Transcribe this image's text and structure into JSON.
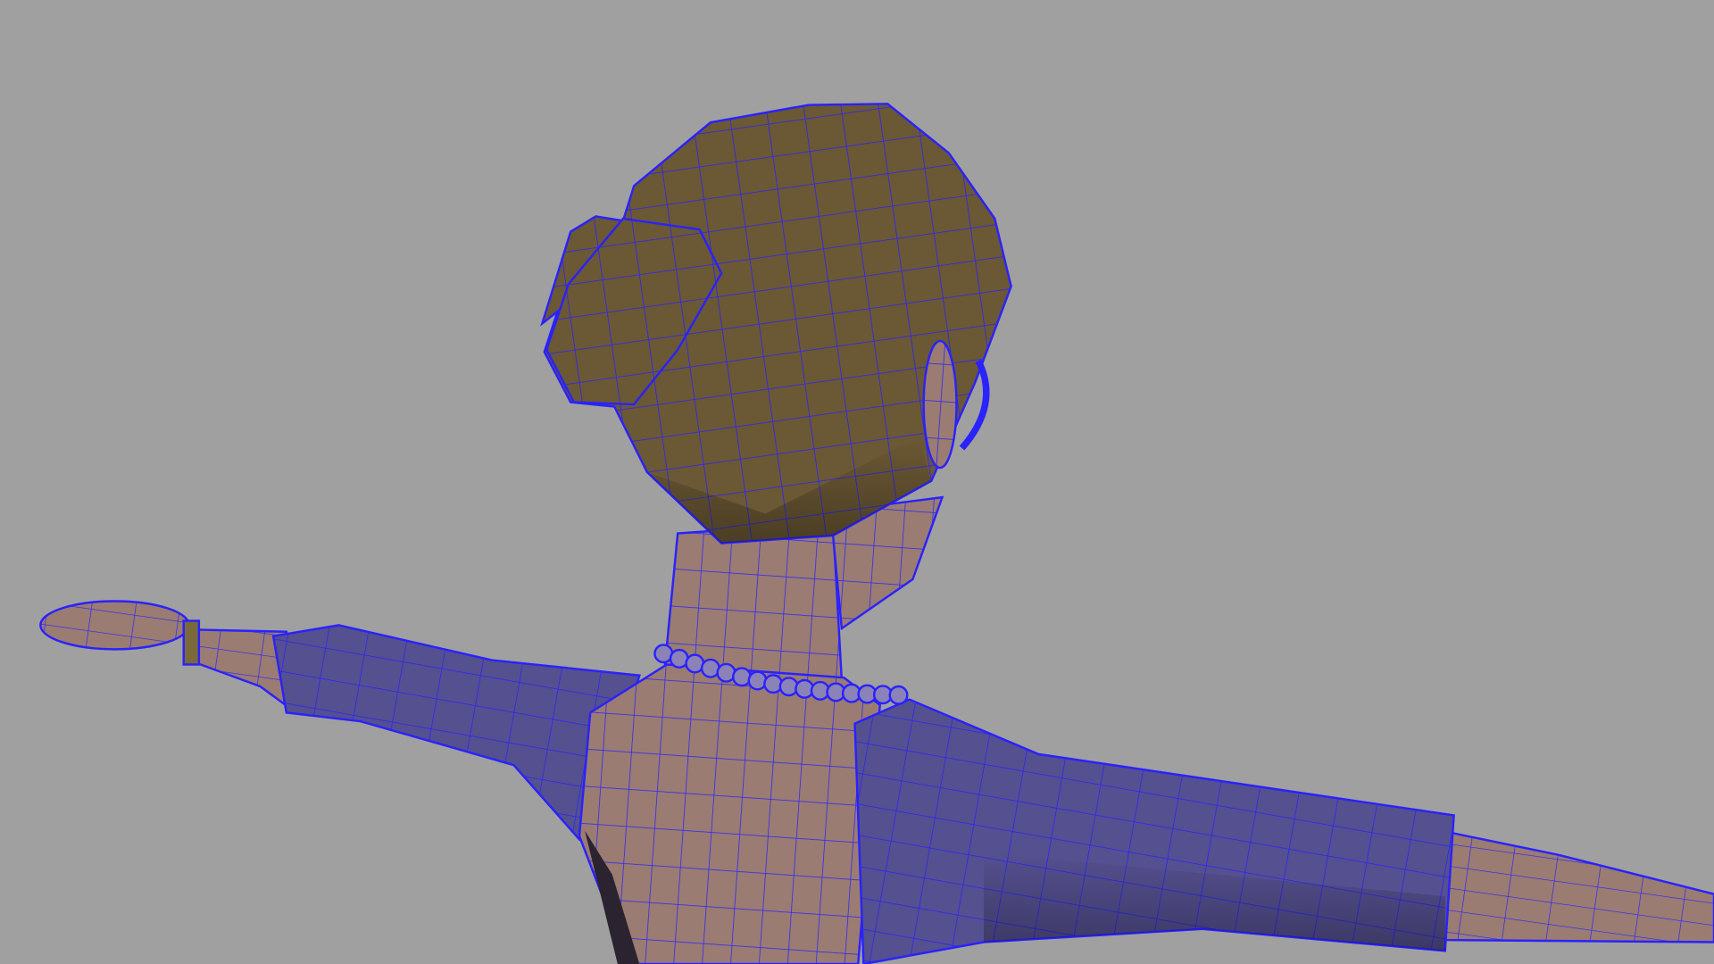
{
  "viewport": {
    "background_color": "#a0a0a0",
    "wire_color": "#2a22ff",
    "hair_color": "#6b5834",
    "skin_color": "#9a7c72",
    "shirt_color": "#55508f"
  }
}
